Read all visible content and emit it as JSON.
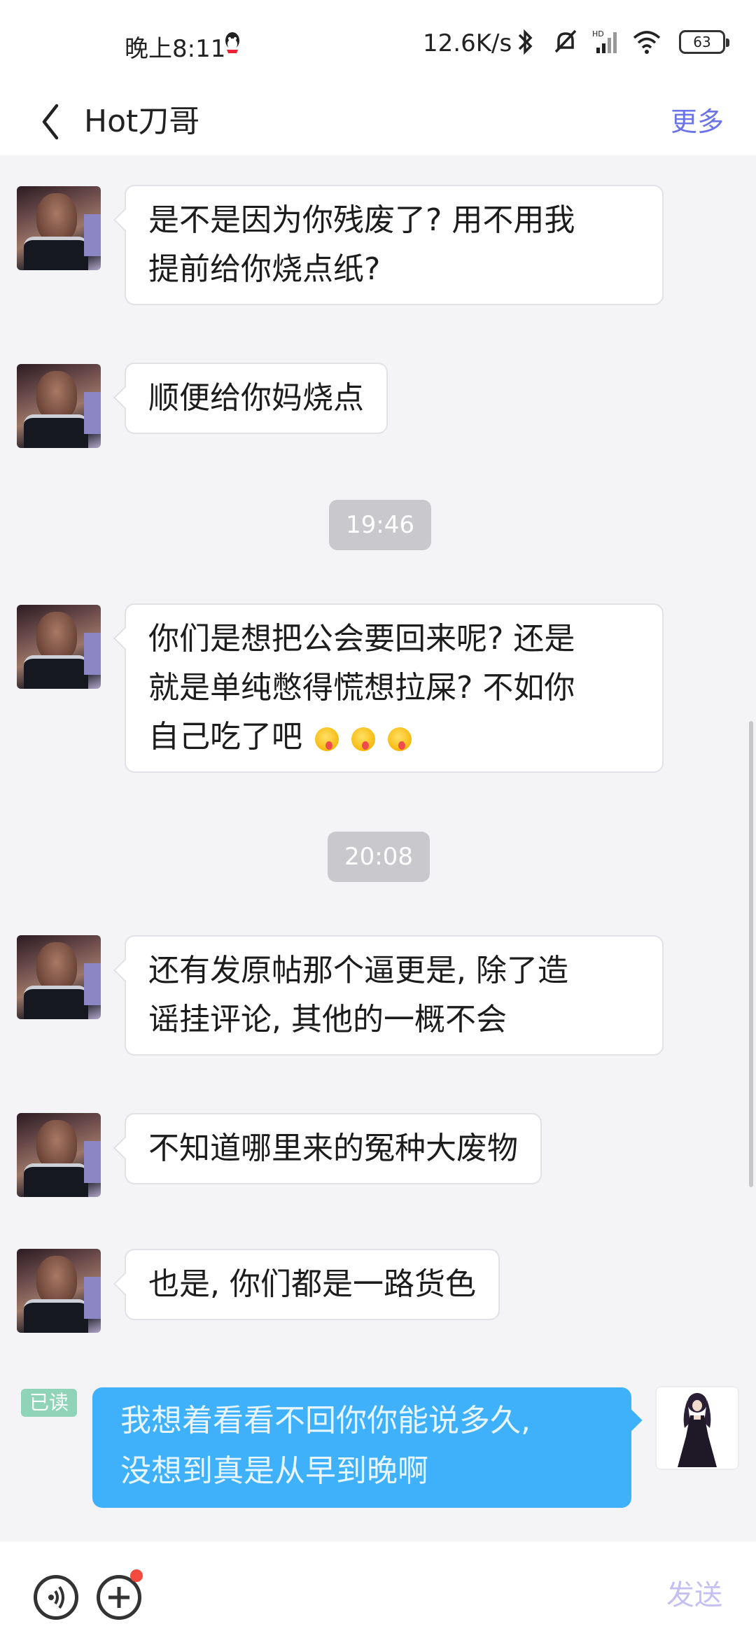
{
  "status_bar": {
    "time": "晚上8:11",
    "net_speed": "12.6K/s",
    "battery": "63"
  },
  "header": {
    "title": "Hot刀哥",
    "more_label": "更多"
  },
  "messages": [
    {
      "line1": "是不是因为你残废了? 用不用我",
      "line2": "提前给你烧点纸?"
    },
    {
      "line1": "顺便给你妈烧点"
    },
    {
      "line1": "你们是想把公会要回来呢? 还是",
      "line2": "就是单纯憋得慌想拉屎? 不如你",
      "line3": "自己吃了吧"
    },
    {
      "line1": "还有发原帖那个逼更是, 除了造",
      "line2": "谣挂评论, 其他的一概不会"
    },
    {
      "line1": "不知道哪里来的冤种大废物"
    },
    {
      "line1": "也是, 你们都是一路货色"
    }
  ],
  "timestamps": [
    "19:46",
    "20:08"
  ],
  "outgoing": {
    "read_label": "已读",
    "line1": "我想着看看不回你你能说多久,",
    "line2": "没想到真是从早到晚啊"
  },
  "input_bar": {
    "send_label": "发送"
  },
  "colors": {
    "accent": "#6b73e8",
    "outgoing_bubble": "#3fb0fa",
    "chat_background": "#f4f4f7",
    "read_badge": "#8fd3b9"
  }
}
